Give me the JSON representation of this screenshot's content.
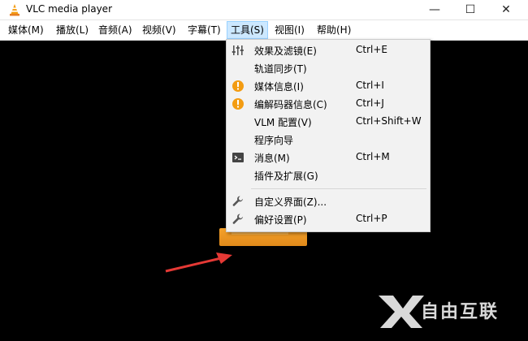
{
  "window": {
    "title": "VLC media player",
    "minimize_glyph": "—",
    "maximize_glyph": "☐",
    "close_glyph": "✕"
  },
  "menubar": {
    "items": [
      {
        "label": "媒体(M)"
      },
      {
        "label": "播放(L)"
      },
      {
        "label": "音频(A)"
      },
      {
        "label": "视频(V)"
      },
      {
        "label": "字幕(T)"
      },
      {
        "label": "工具(S)"
      },
      {
        "label": "视图(I)"
      },
      {
        "label": "帮助(H)"
      }
    ],
    "active_index": 5
  },
  "tools_menu": {
    "items": [
      {
        "icon": "equalizer-icon",
        "label": "效果及滤镜(E)",
        "shortcut": "Ctrl+E"
      },
      {
        "icon": "",
        "label": "轨道同步(T)",
        "shortcut": ""
      },
      {
        "icon": "info-icon",
        "label": "媒体信息(I)",
        "shortcut": "Ctrl+I"
      },
      {
        "icon": "info-icon",
        "label": "编解码器信息(C)",
        "shortcut": "Ctrl+J"
      },
      {
        "icon": "",
        "label": "VLM 配置(V)",
        "shortcut": "Ctrl+Shift+W"
      },
      {
        "icon": "",
        "label": "程序向导",
        "shortcut": ""
      },
      {
        "icon": "terminal-icon",
        "label": "消息(M)",
        "shortcut": "Ctrl+M"
      },
      {
        "icon": "",
        "label": "插件及扩展(G)",
        "shortcut": ""
      },
      {
        "icon": "wrench-icon",
        "label": "自定义界面(Z)...",
        "shortcut": ""
      },
      {
        "icon": "wrench-icon",
        "label": "偏好设置(P)",
        "shortcut": "Ctrl+P"
      }
    ]
  },
  "watermark": {
    "text": "自由互联"
  },
  "colors": {
    "accent_orange": "#f39c12",
    "arrow_red": "#e53935",
    "menu_highlight": "#cce8ff"
  }
}
